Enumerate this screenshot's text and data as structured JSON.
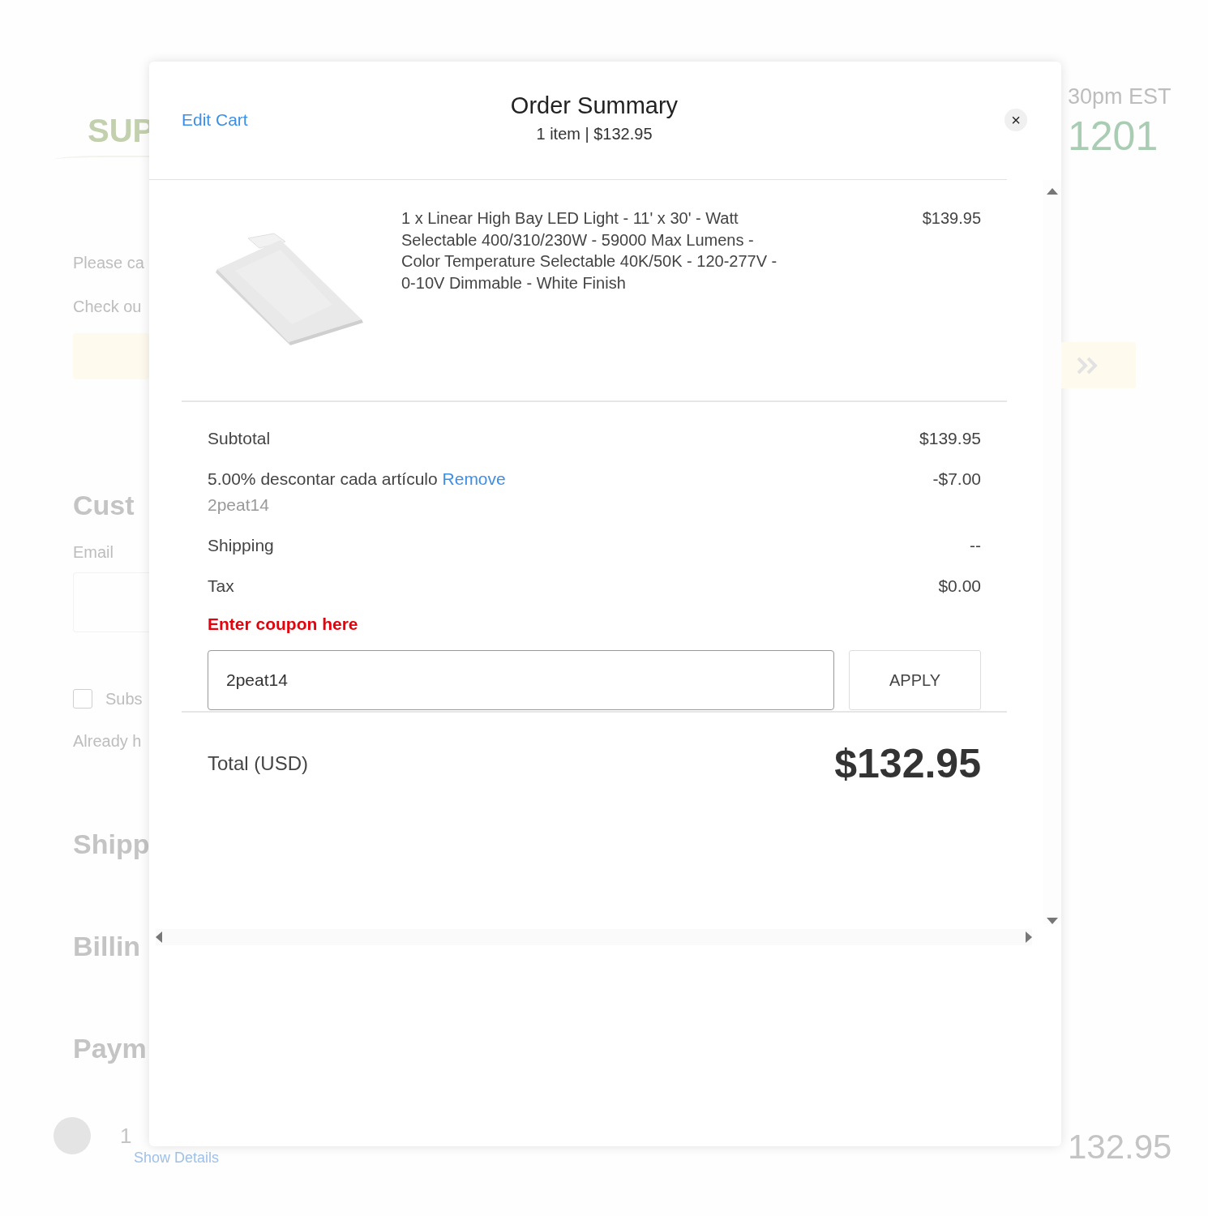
{
  "background": {
    "logo": "SUP",
    "notice": "Please ca",
    "checkout": "Check ou",
    "customer_heading": "Cust",
    "email_label": "Email",
    "subscribe": "Subs",
    "subscribe_checked": false,
    "already": "Already h",
    "shipping_heading": "Shipp",
    "billing_heading": "Billin",
    "payment_heading": "Paym",
    "hours": "30pm EST",
    "phone": "1201",
    "bar_count": "1",
    "bar_link": "Show Details",
    "bar_total": "132.95"
  },
  "header": {
    "edit_link": "Edit Cart",
    "title": "Order Summary",
    "subtitle": "1 item | $132.95",
    "close": "×"
  },
  "items": [
    {
      "kind": "picture",
      "description": "1 x Linear High Bay LED Light - 11' x 30' - Watt Selectable 400/310/230W - 59000 Max Lumens - Color Temperature Selectable 40K/50K - 120-277V - 0-10V Dimmable - White Finish",
      "price": "$139.95"
    }
  ],
  "summary": [
    {
      "kind": "plain",
      "label": "Subtotal",
      "value": "$139.95"
    },
    {
      "kind": "discount",
      "label": "5.00% descontar cada artículo",
      "link": "Remove",
      "code": "2peat14",
      "value": "-$7.00"
    },
    {
      "kind": "plain",
      "label": "Shipping",
      "value": "--"
    },
    {
      "kind": "plain",
      "label": "Tax",
      "value": "$0.00"
    }
  ],
  "coupon": {
    "label": "Enter coupon here",
    "value": "2peat14",
    "button": "APPLY"
  },
  "total": {
    "label": "Total (USD)",
    "value": "$132.95"
  }
}
